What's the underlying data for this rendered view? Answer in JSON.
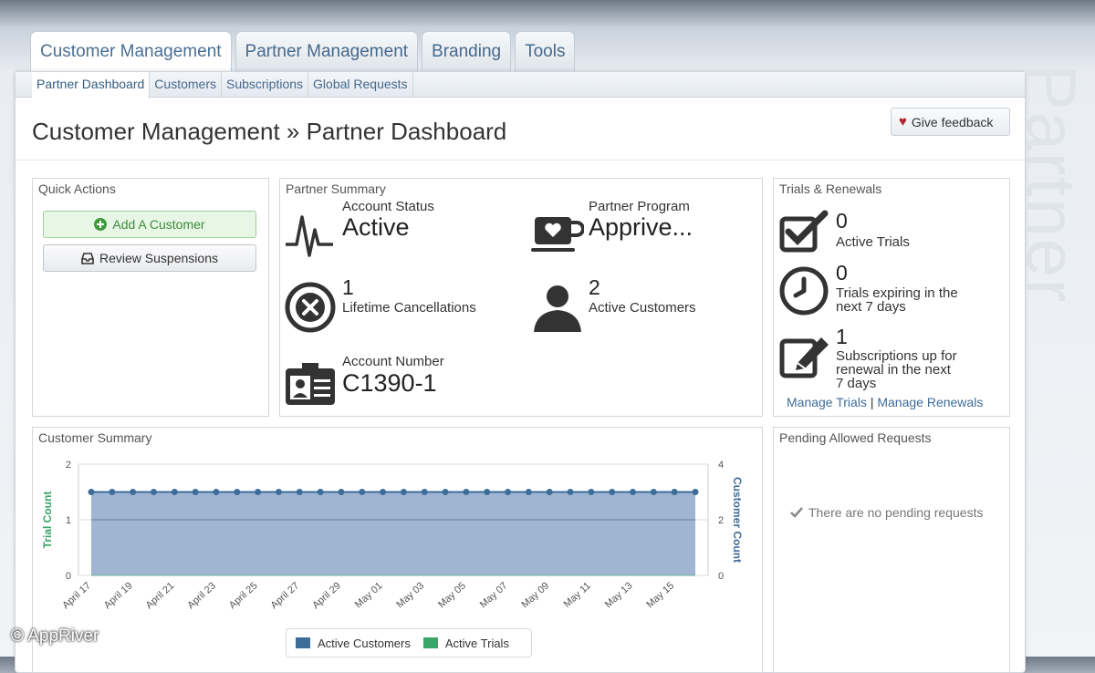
{
  "main_tabs": [
    {
      "label": "Customer Management"
    },
    {
      "label": "Partner Management"
    },
    {
      "label": "Branding"
    },
    {
      "label": "Tools"
    }
  ],
  "sub_tabs": [
    {
      "label": "Partner Dashboard"
    },
    {
      "label": "Customers"
    },
    {
      "label": "Subscriptions"
    },
    {
      "label": "Global Requests"
    }
  ],
  "page_title": "Customer Management » Partner Dashboard",
  "feedback_label": "Give feedback",
  "background_watermark": "Partner",
  "copyright": "© AppRiver",
  "quick_actions": {
    "title": "Quick Actions",
    "add_customer": "Add A Customer",
    "review_suspensions": "Review Suspensions"
  },
  "partner_summary": {
    "title": "Partner Summary",
    "account_status_label": "Account Status",
    "account_status_value": "Active",
    "partner_program_label": "Partner Program",
    "partner_program_value": "Apprive...",
    "cancellations_value": "1",
    "cancellations_label": "Lifetime Cancellations",
    "active_customers_value": "2",
    "active_customers_label": "Active Customers",
    "account_number_label": "Account Number",
    "account_number_value": "C1390-1"
  },
  "trials": {
    "title": "Trials & Renewals",
    "active_trials_value": "0",
    "active_trials_label": "Active Trials",
    "expiring_value": "0",
    "expiring_label_1": "Trials expiring in the",
    "expiring_label_2": "next 7 days",
    "renewal_value": "1",
    "renewal_label_1": "Subscriptions up for",
    "renewal_label_2": "renewal in the next",
    "renewal_label_3": "7 days",
    "manage_trials": "Manage Trials",
    "separator": "|",
    "manage_renewals": "Manage Renewals"
  },
  "customer_summary": {
    "title": "Customer Summary"
  },
  "pending": {
    "title": "Pending Allowed Requests",
    "empty_message": "There are no pending requests"
  },
  "colors": {
    "link": "#3f6d9a",
    "customers_series": "#3f6d9a",
    "customers_fill": "#9fb5d1",
    "trials_series": "#3aa46a"
  },
  "chart_data": {
    "type": "area",
    "x": [
      "April 17",
      "April 18",
      "April 19",
      "April 20",
      "April 21",
      "April 22",
      "April 23",
      "April 24",
      "April 25",
      "April 26",
      "April 27",
      "April 28",
      "April 29",
      "April 30",
      "May 01",
      "May 02",
      "May 03",
      "May 04",
      "May 05",
      "May 06",
      "May 07",
      "May 08",
      "May 09",
      "May 10",
      "May 11",
      "May 12",
      "May 13",
      "May 14",
      "May 15",
      "May 16"
    ],
    "tick_labels": [
      "April 17",
      "April 19",
      "April 21",
      "April 23",
      "April 25",
      "April 27",
      "April 29",
      "May 01",
      "May 03",
      "May 05",
      "May 07",
      "May 09",
      "May 11",
      "May 13",
      "May 15"
    ],
    "series": [
      {
        "name": "Active Customers",
        "axis": "right",
        "values": [
          3,
          3,
          3,
          3,
          3,
          3,
          3,
          3,
          3,
          3,
          3,
          3,
          3,
          3,
          3,
          3,
          3,
          3,
          3,
          3,
          3,
          3,
          3,
          3,
          3,
          3,
          3,
          3,
          3,
          3
        ]
      },
      {
        "name": "Active Trials",
        "axis": "left",
        "values": [
          0,
          0,
          0,
          0,
          0,
          0,
          0,
          0,
          0,
          0,
          0,
          0,
          0,
          0,
          0,
          0,
          0,
          0,
          0,
          0,
          0,
          0,
          0,
          0,
          0,
          0,
          0,
          0,
          0,
          0
        ]
      }
    ],
    "ylabel_left": "Trial Count",
    "ylabel_right": "Customer Count",
    "ylim_left": [
      0,
      2
    ],
    "ylim_right": [
      0,
      4
    ],
    "yticks_left": [
      "0",
      "1",
      "2"
    ],
    "yticks_right": [
      "0",
      "2",
      "4"
    ],
    "grid": true,
    "legend": "bottom"
  }
}
